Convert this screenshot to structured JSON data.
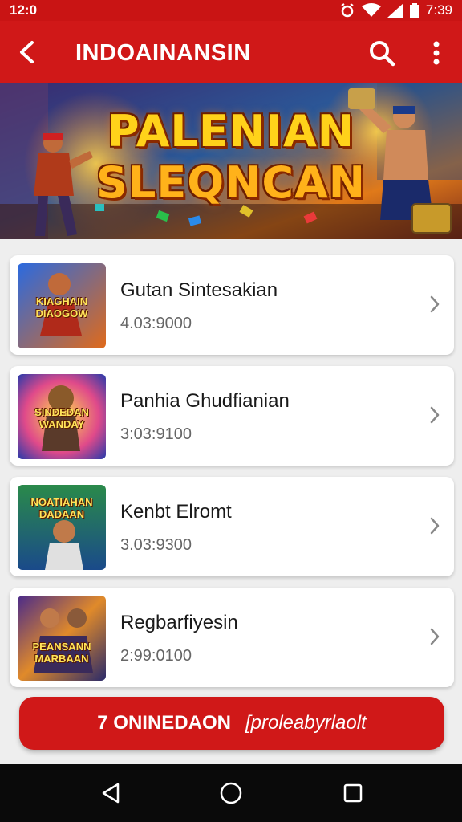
{
  "status_bar": {
    "left_text": "12:0",
    "clock": "7:39"
  },
  "app_bar": {
    "title": "INDOAINANSIN",
    "icons": [
      "back-arrow-icon",
      "search-icon",
      "more-vert-icon"
    ]
  },
  "banner": {
    "line1": "PALENIAN",
    "line2": "SLEQNCAN"
  },
  "items": [
    {
      "name": "Gutan Sintesakian",
      "meta": "4.03:9000",
      "thumb_text": "KIAGHAIN DIAOGOW"
    },
    {
      "name": "Panhia Ghudfianian",
      "meta": "3:03:9100",
      "thumb_text": "SINDEDAN WANDAY"
    },
    {
      "name": "Kenbt Elromt",
      "meta": "3.03:9300",
      "thumb_text": "NOATIAHAN DADAAN"
    },
    {
      "name": "Regbarfiyesin",
      "meta": "2:99:0100",
      "thumb_text": "PEANSANN MARBAAN"
    }
  ],
  "cta": {
    "label": "7 ONINEDAON",
    "sub": "[proleabyrlaolt"
  },
  "nav_bar": {
    "icons": [
      "back-triangle-icon",
      "home-circle-icon",
      "recents-square-icon"
    ]
  },
  "colors": {
    "primary_red": "#d01818",
    "status_red": "#c91414"
  }
}
